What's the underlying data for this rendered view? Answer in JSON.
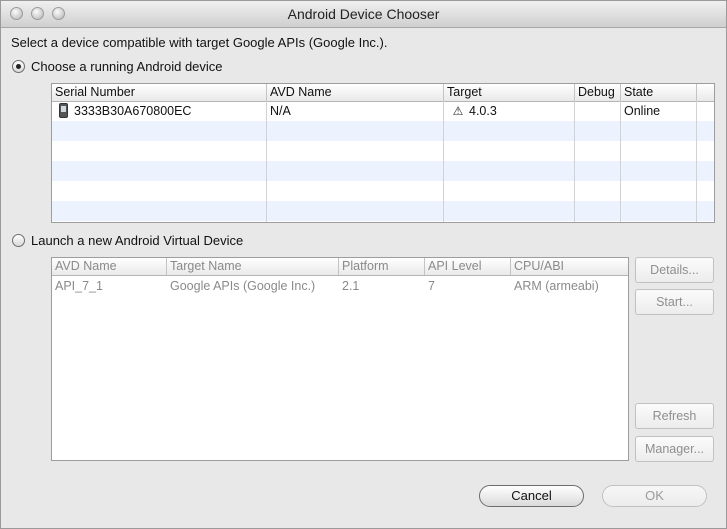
{
  "window": {
    "title": "Android Device Chooser"
  },
  "intro_text": "Select a device compatible with target Google APIs (Google Inc.).",
  "running": {
    "radio_label": "Choose a running Android device",
    "selected": true,
    "columns": [
      "Serial Number",
      "AVD Name",
      "Target",
      "Debug",
      "State"
    ],
    "rows": [
      {
        "icon": "phone-icon",
        "serial": "3333B30A670800EC",
        "avd_name": "N/A",
        "target_icon": "warning-icon",
        "target": "4.0.3",
        "debug": "",
        "state": "Online"
      }
    ]
  },
  "avd": {
    "radio_label": "Launch a new Android Virtual Device",
    "selected": false,
    "columns": [
      "AVD Name",
      "Target Name",
      "Platform",
      "API Level",
      "CPU/ABI"
    ],
    "rows": [
      {
        "avd_name": "API_7_1",
        "target_name": "Google APIs (Google Inc.)",
        "platform": "2.1",
        "api_level": "7",
        "cpu_abi": "ARM (armeabi)"
      }
    ],
    "buttons": {
      "details": "Details...",
      "start": "Start...",
      "refresh": "Refresh",
      "manager": "Manager..."
    }
  },
  "footer": {
    "cancel": "Cancel",
    "ok": "OK"
  },
  "colors": {
    "row_alternate": "#edf3fe",
    "window_bg": "#e8e8e8"
  }
}
